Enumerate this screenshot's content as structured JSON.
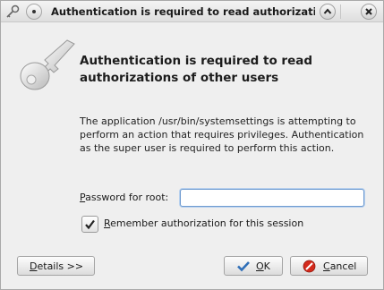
{
  "window": {
    "title": "Authentication is required to read authorizations of other users"
  },
  "heading": "Authentication is required to read authorizations of other users",
  "description": "The application /usr/bin/systemsettings is attempting to perform an action that requires privileges. Authentication as the super user is required to perform this action.",
  "password": {
    "label_mnemonic": "P",
    "label_rest": "assword for root:",
    "value": ""
  },
  "remember": {
    "checked": true,
    "label_mnemonic": "R",
    "label_rest": "emember authorization for this session"
  },
  "buttons": {
    "details_mnemonic": "D",
    "details_rest": "etails >>",
    "ok_mnemonic": "O",
    "ok_rest": "K",
    "cancel_mnemonic": "C",
    "cancel_rest": "ancel"
  },
  "colors": {
    "accent": "#6f9bd0",
    "ok_check": "#2f6fb8",
    "cancel_red": "#d42a1c"
  },
  "icons": {
    "app": "key-icon",
    "pin": "pin-icon",
    "maximize": "chevron-up-icon",
    "close": "close-icon",
    "ok": "checkmark-icon",
    "cancel": "no-entry-icon"
  }
}
